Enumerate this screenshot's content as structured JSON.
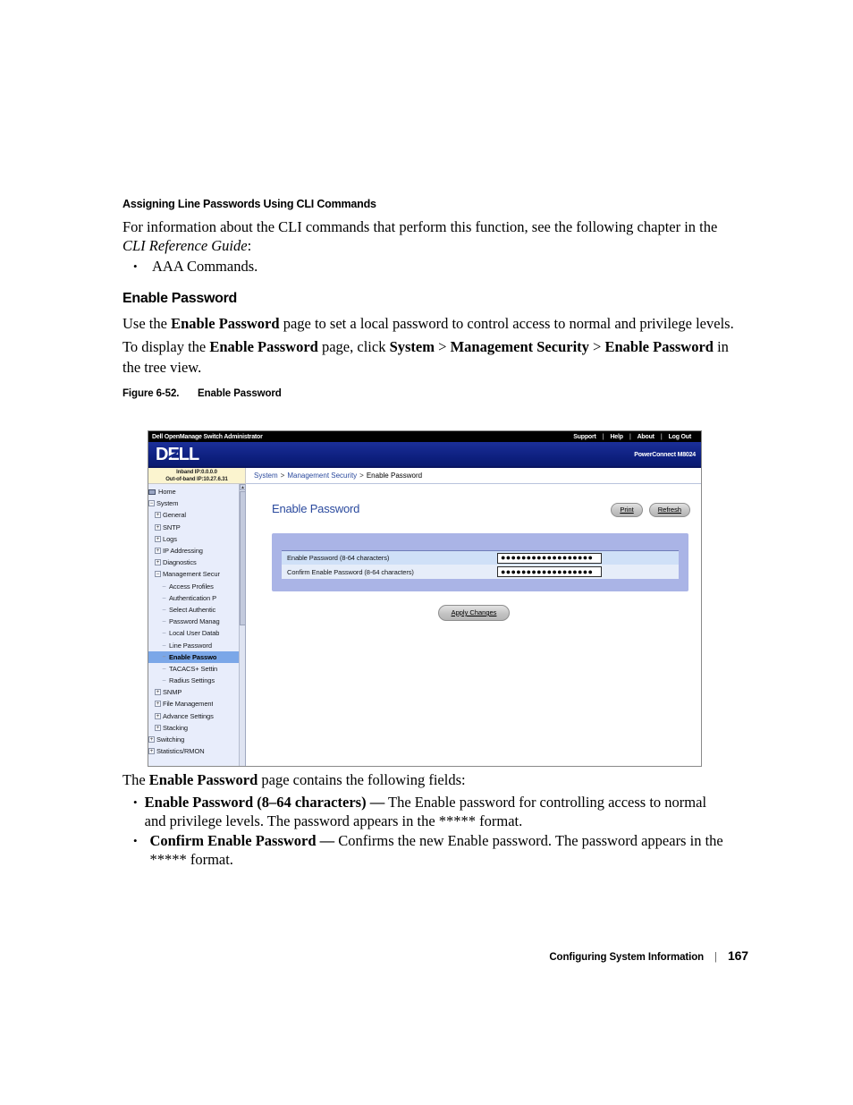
{
  "doc": {
    "section_heading": "Assigning Line Passwords Using CLI Commands",
    "para_cli_a": "For information about the CLI commands that perform this function, see the following chapter in the ",
    "para_cli_italic": "CLI Reference Guide",
    "para_cli_b": ":",
    "bullet_aaa": "AAA Commands.",
    "h2_enable_password": "Enable Password",
    "para_use_a": "Use the ",
    "para_use_bold": "Enable Password",
    "para_use_b": " page to set a local password to control access to normal and privilege levels.",
    "para_display_a": "To display the ",
    "para_display_bold1": "Enable Password",
    "para_display_b": " page, click ",
    "para_display_bold2": "System",
    "para_display_c": " > ",
    "para_display_bold3": "Management Security",
    "para_display_d": " > ",
    "para_display_bold4": "Enable Password",
    "para_display_e": " in the tree view.",
    "figure_number": "Figure 6-52.",
    "figure_title": "Enable Password",
    "para_fields_a": "The ",
    "para_fields_bold": "Enable Password",
    "para_fields_b": " page contains the following fields:",
    "bullet1_bold": "Enable Password (8–64 characters) —",
    "bullet1_text": " The Enable password for controlling access to normal and privilege levels. The password appears in the ***** format.",
    "bullet2_bold": "Confirm Enable Password —",
    "bullet2_text": " Confirms the new Enable password. The password appears in the ***** format.",
    "footer_title": "Configuring System Information",
    "footer_separator": "|",
    "footer_page": "167"
  },
  "screenshot": {
    "titlebar": {
      "app_title": "Dell OpenManage Switch Administrator",
      "links": [
        "Support",
        "Help",
        "About",
        "Log Out"
      ]
    },
    "brandbar": {
      "logo_text_1": "D",
      "logo_text_2": "E",
      "logo_text_3": "LL",
      "model": "PowerConnect M8024"
    },
    "ipbox": {
      "inband": "Inband IP:0.0.0.0",
      "outofband": "Out-of-band IP:10.27.6.31"
    },
    "breadcrumb": {
      "item1": "System",
      "sep1": ">",
      "item2": "Management Security",
      "sep2": ">",
      "item3": "Enable Password"
    },
    "tree": {
      "scroll_up": "▲",
      "items": [
        {
          "label": "Home",
          "depth": 0,
          "marker": "home",
          "selected": false
        },
        {
          "label": "System",
          "depth": 0,
          "marker": "minus",
          "selected": false
        },
        {
          "label": "General",
          "depth": 1,
          "marker": "plus",
          "selected": false
        },
        {
          "label": "SNTP",
          "depth": 1,
          "marker": "plus",
          "selected": false
        },
        {
          "label": "Logs",
          "depth": 1,
          "marker": "plus",
          "selected": false
        },
        {
          "label": "IP Addressing",
          "depth": 1,
          "marker": "plus",
          "selected": false
        },
        {
          "label": "Diagnostics",
          "depth": 1,
          "marker": "plus",
          "selected": false
        },
        {
          "label": "Management Secur",
          "depth": 1,
          "marker": "minus",
          "selected": false
        },
        {
          "label": "Access Profiles",
          "depth": 2,
          "marker": "leaf",
          "selected": false
        },
        {
          "label": "Authentication P",
          "depth": 2,
          "marker": "leaf",
          "selected": false
        },
        {
          "label": "Select Authentic",
          "depth": 2,
          "marker": "leaf",
          "selected": false
        },
        {
          "label": "Password Manag",
          "depth": 2,
          "marker": "leaf",
          "selected": false
        },
        {
          "label": "Local User Datab",
          "depth": 2,
          "marker": "leaf",
          "selected": false
        },
        {
          "label": "Line Password",
          "depth": 2,
          "marker": "leaf",
          "selected": false
        },
        {
          "label": "Enable Passwo",
          "depth": 2,
          "marker": "leaf",
          "selected": true
        },
        {
          "label": "TACACS+ Settin",
          "depth": 2,
          "marker": "leaf",
          "selected": false
        },
        {
          "label": "Radius Settings",
          "depth": 2,
          "marker": "leaf",
          "selected": false
        },
        {
          "label": "SNMP",
          "depth": 1,
          "marker": "plus",
          "selected": false
        },
        {
          "label": "File Management",
          "depth": 1,
          "marker": "plus",
          "selected": false
        },
        {
          "label": "Advance Settings",
          "depth": 1,
          "marker": "plus",
          "selected": false
        },
        {
          "label": "Stacking",
          "depth": 1,
          "marker": "plus",
          "selected": false
        },
        {
          "label": "Switching",
          "depth": 0,
          "marker": "plus",
          "selected": false
        },
        {
          "label": "Statistics/RMON",
          "depth": 0,
          "marker": "plus",
          "selected": false
        }
      ]
    },
    "content": {
      "page_title": "Enable Password",
      "print_label": "Print",
      "refresh_label": "Refresh",
      "apply_label": "Apply Changes",
      "fields": [
        {
          "label": "Enable Password (8-64 characters)",
          "value": "●●●●●●●●●●●●●●●●●●"
        },
        {
          "label": "Confirm Enable Password (8-64 characters)",
          "value": "●●●●●●●●●●●●●●●●●●"
        }
      ]
    }
  }
}
